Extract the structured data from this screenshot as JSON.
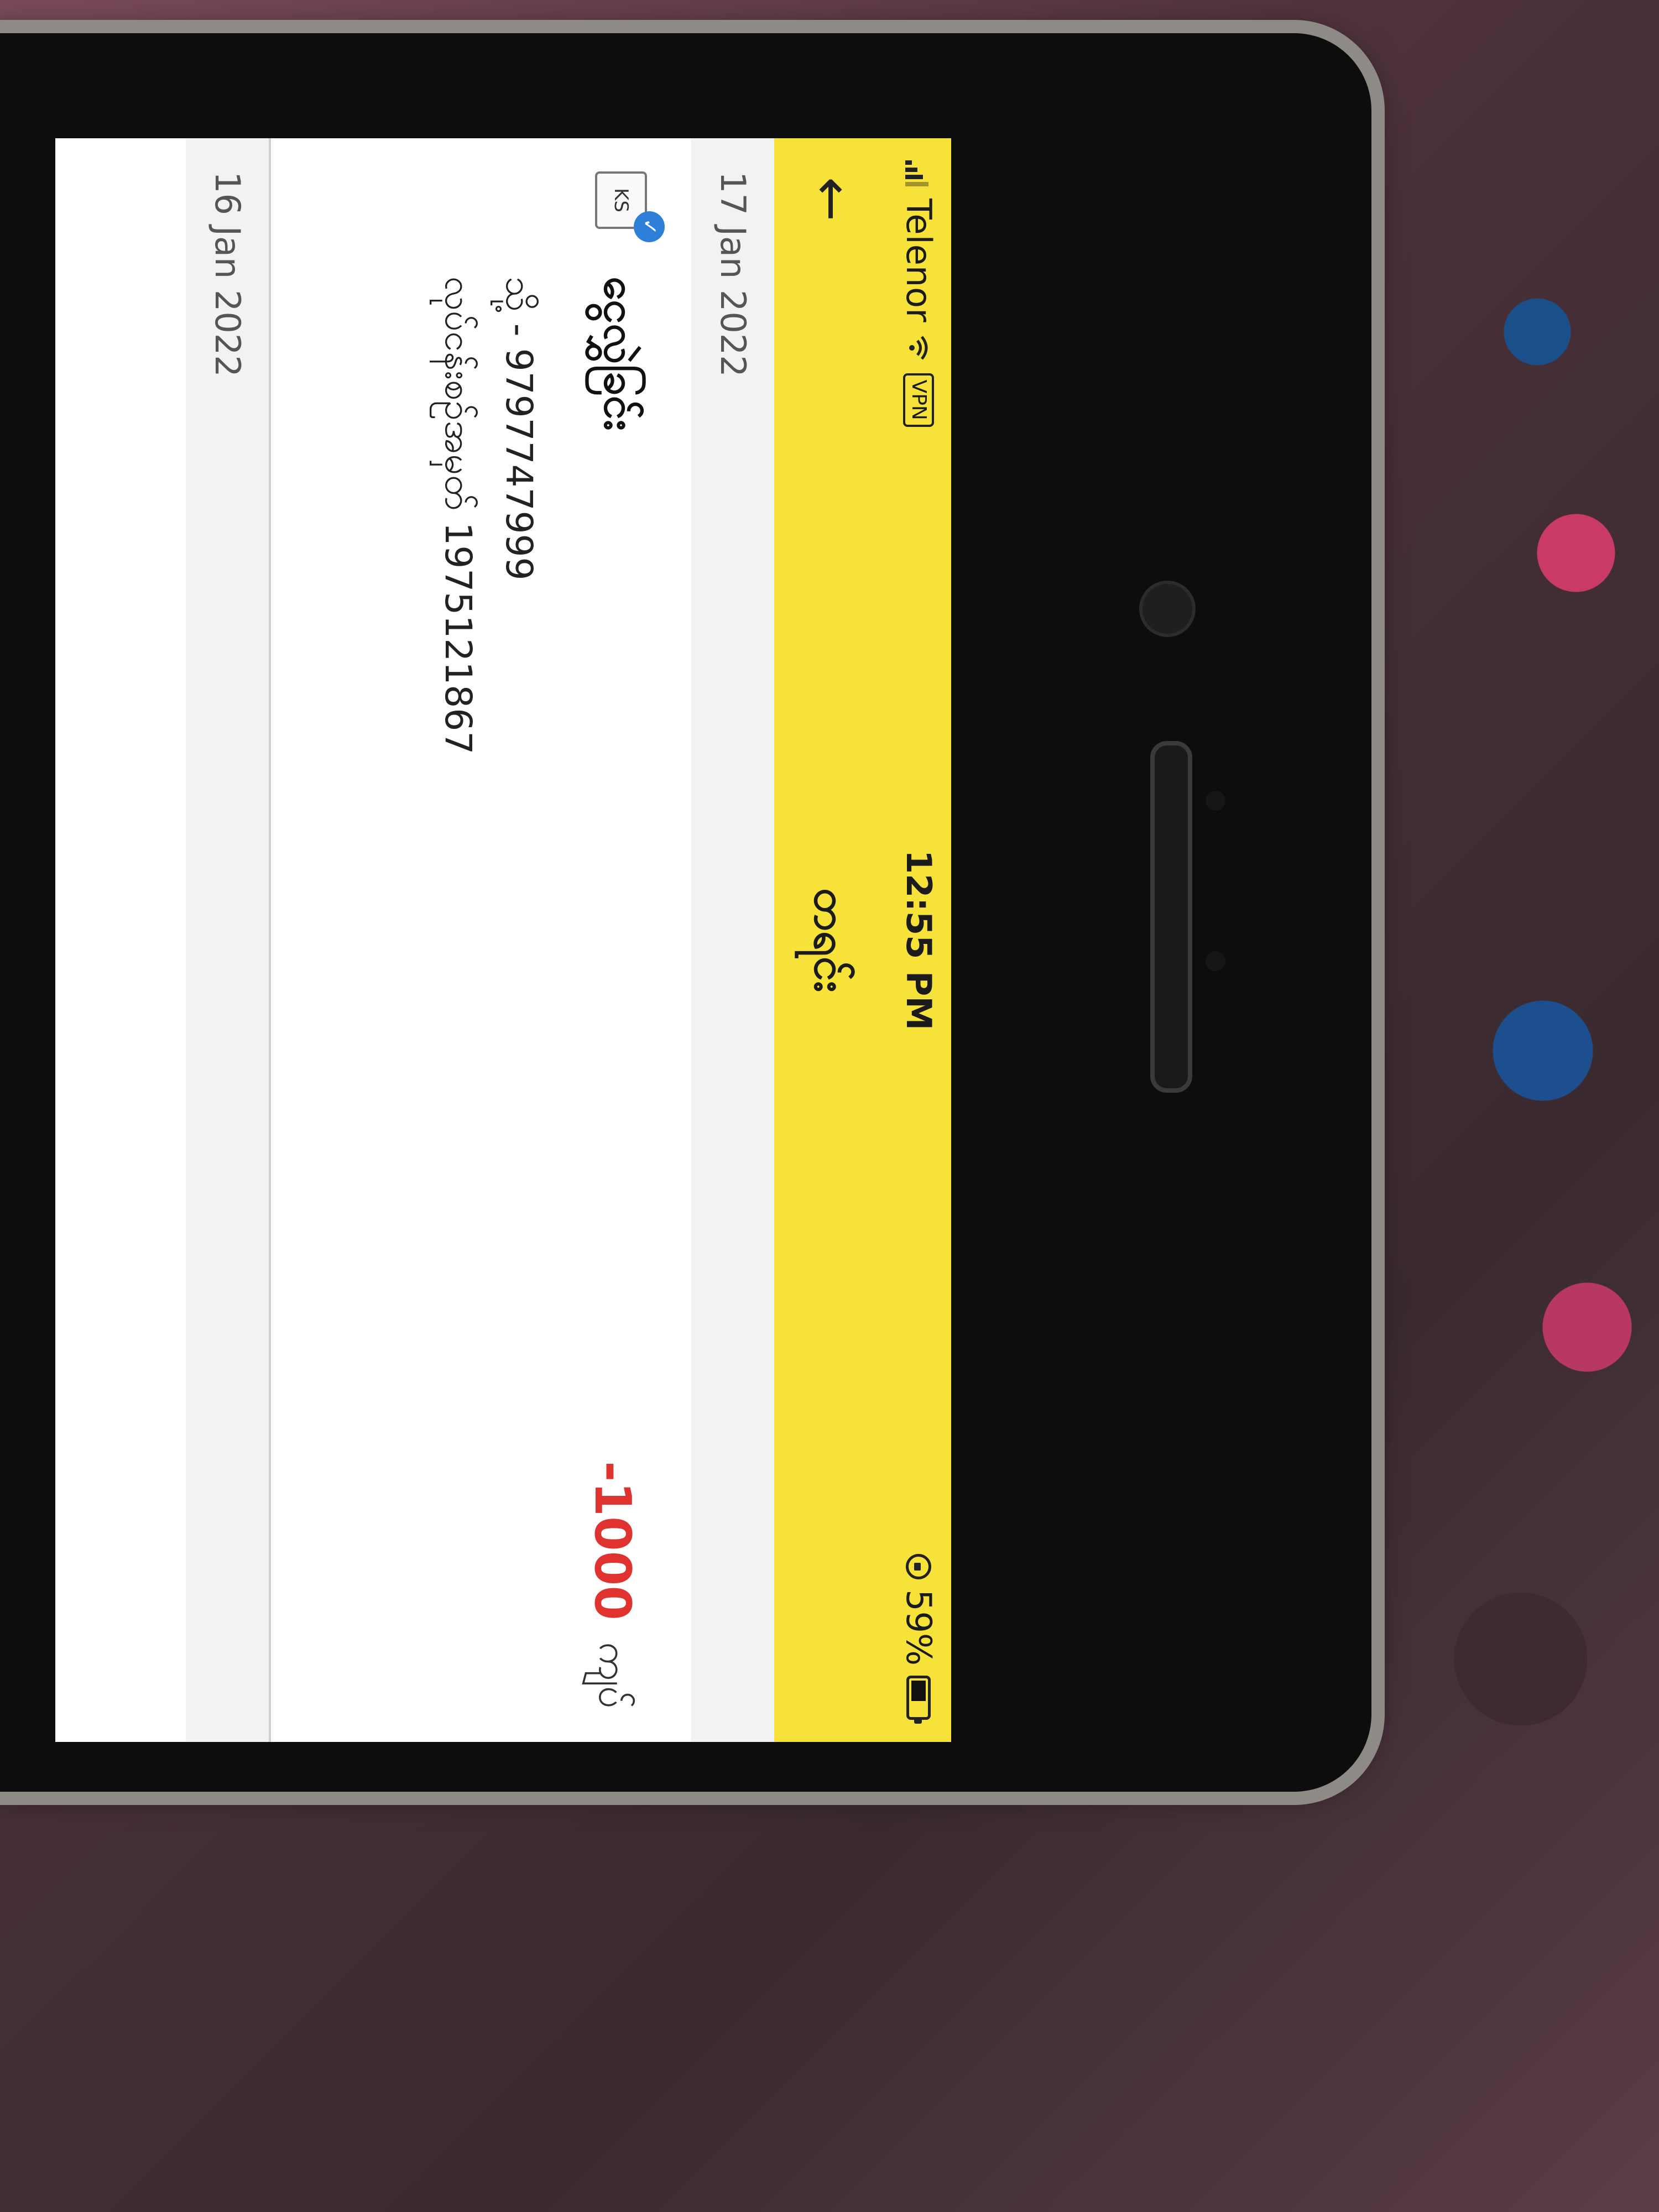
{
  "status_bar": {
    "carrier": "Telenor",
    "vpn": "VPN",
    "time": "12:55 PM",
    "battery": "59%",
    "battery_level": 0.59
  },
  "app_bar": {
    "title": "တရင်း"
  },
  "groups": [
    {
      "date": "17 Jan 2022",
      "transaction": {
        "badge": "KS",
        "type": "ငွေလွှဲခြင်း",
        "amount": "-1000",
        "unit": "ကျပ်",
        "to_line": "သို့ - 9797747999",
        "txn_line": "လုပ်ငန်းစဉ်အမှတ် 1975121867"
      }
    },
    {
      "date": "16 Jan 2022"
    }
  ]
}
